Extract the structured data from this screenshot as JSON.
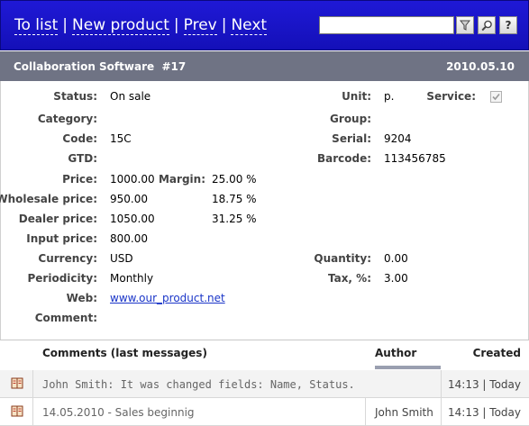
{
  "nav": {
    "to_list": "To list",
    "new_product": "New product",
    "prev": "Prev",
    "next": "Next",
    "separator": "|"
  },
  "search": {
    "value": ""
  },
  "toolbar_icons": [
    "filter-icon",
    "magnifier-icon",
    "help-icon"
  ],
  "toolbar_help_label": "?",
  "title": {
    "name": "Collaboration Software  #17",
    "date": "2010.05.10"
  },
  "fields": {
    "status_label": "Status:",
    "status": "On sale",
    "unit_label": "Unit:",
    "unit": "p.",
    "service_label": "Service:",
    "category_label": "Category:",
    "category": "",
    "group_label": "Group:",
    "group": "",
    "code_label": "Code:",
    "code": "15C",
    "serial_label": "Serial:",
    "serial": "9204",
    "gtd_label": "GTD:",
    "gtd": "",
    "barcode_label": "Barcode:",
    "barcode": "113456785",
    "price_label": "Price:",
    "price": "1000.00",
    "margin_label": "Margin:",
    "margin": "25.00 %",
    "wholesale_label": "Wholesale price:",
    "wholesale": "950.00",
    "wholesale_margin": "18.75 %",
    "dealer_label": "Dealer price:",
    "dealer": "1050.00",
    "dealer_margin": "31.25 %",
    "input_label": "Input price:",
    "input": "800.00",
    "currency_label": "Currency:",
    "currency": "USD",
    "quantity_label": "Quantity:",
    "quantity": "0.00",
    "periodicity_label": "Periodicity:",
    "periodicity": "Monthly",
    "tax_label": "Tax, %:",
    "tax": "3.00",
    "web_label": "Web:",
    "web": "www.our_product.net",
    "comment_label": "Comment:",
    "comment": ""
  },
  "comments": {
    "header_title": "Comments (last messages)",
    "header_author": "Author",
    "header_created": "Created",
    "rows": [
      {
        "message": "John Smith: It was changed fields: Name, Status.",
        "author": "",
        "created": "14:13 | Today"
      },
      {
        "message": "14.05.2010 - Sales beginnig",
        "author": "John Smith",
        "created": "14:13 | Today"
      }
    ]
  },
  "colors": {
    "topbar": "#1410b8",
    "titlebar": "#6f7384",
    "link": "#1a35c8"
  }
}
